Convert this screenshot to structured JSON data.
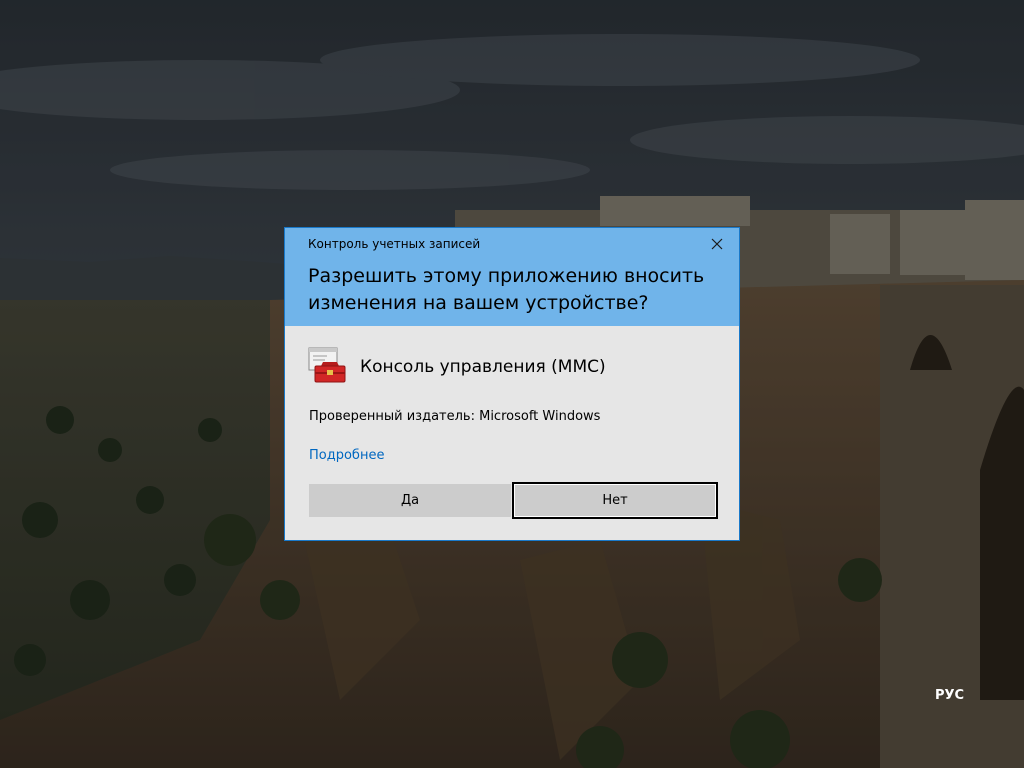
{
  "dialog": {
    "caption": "Контроль учетных записей",
    "question": "Разрешить этому приложению вносить изменения на вашем устройстве?",
    "app_name": "Консоль управления (MMC)",
    "publisher": "Проверенный издатель: Microsoft Windows",
    "details_link": "Подробнее",
    "yes_label": "Да",
    "no_label": "Нет",
    "close_icon": "close-icon",
    "app_icon": "toolbox-icon"
  },
  "taskbar": {
    "language": "РУС"
  },
  "colors": {
    "header": "#70b4ea",
    "dialog_body": "#e6e6e6",
    "border": "#1979ca",
    "link": "#0067c0",
    "button": "#cccccc"
  }
}
